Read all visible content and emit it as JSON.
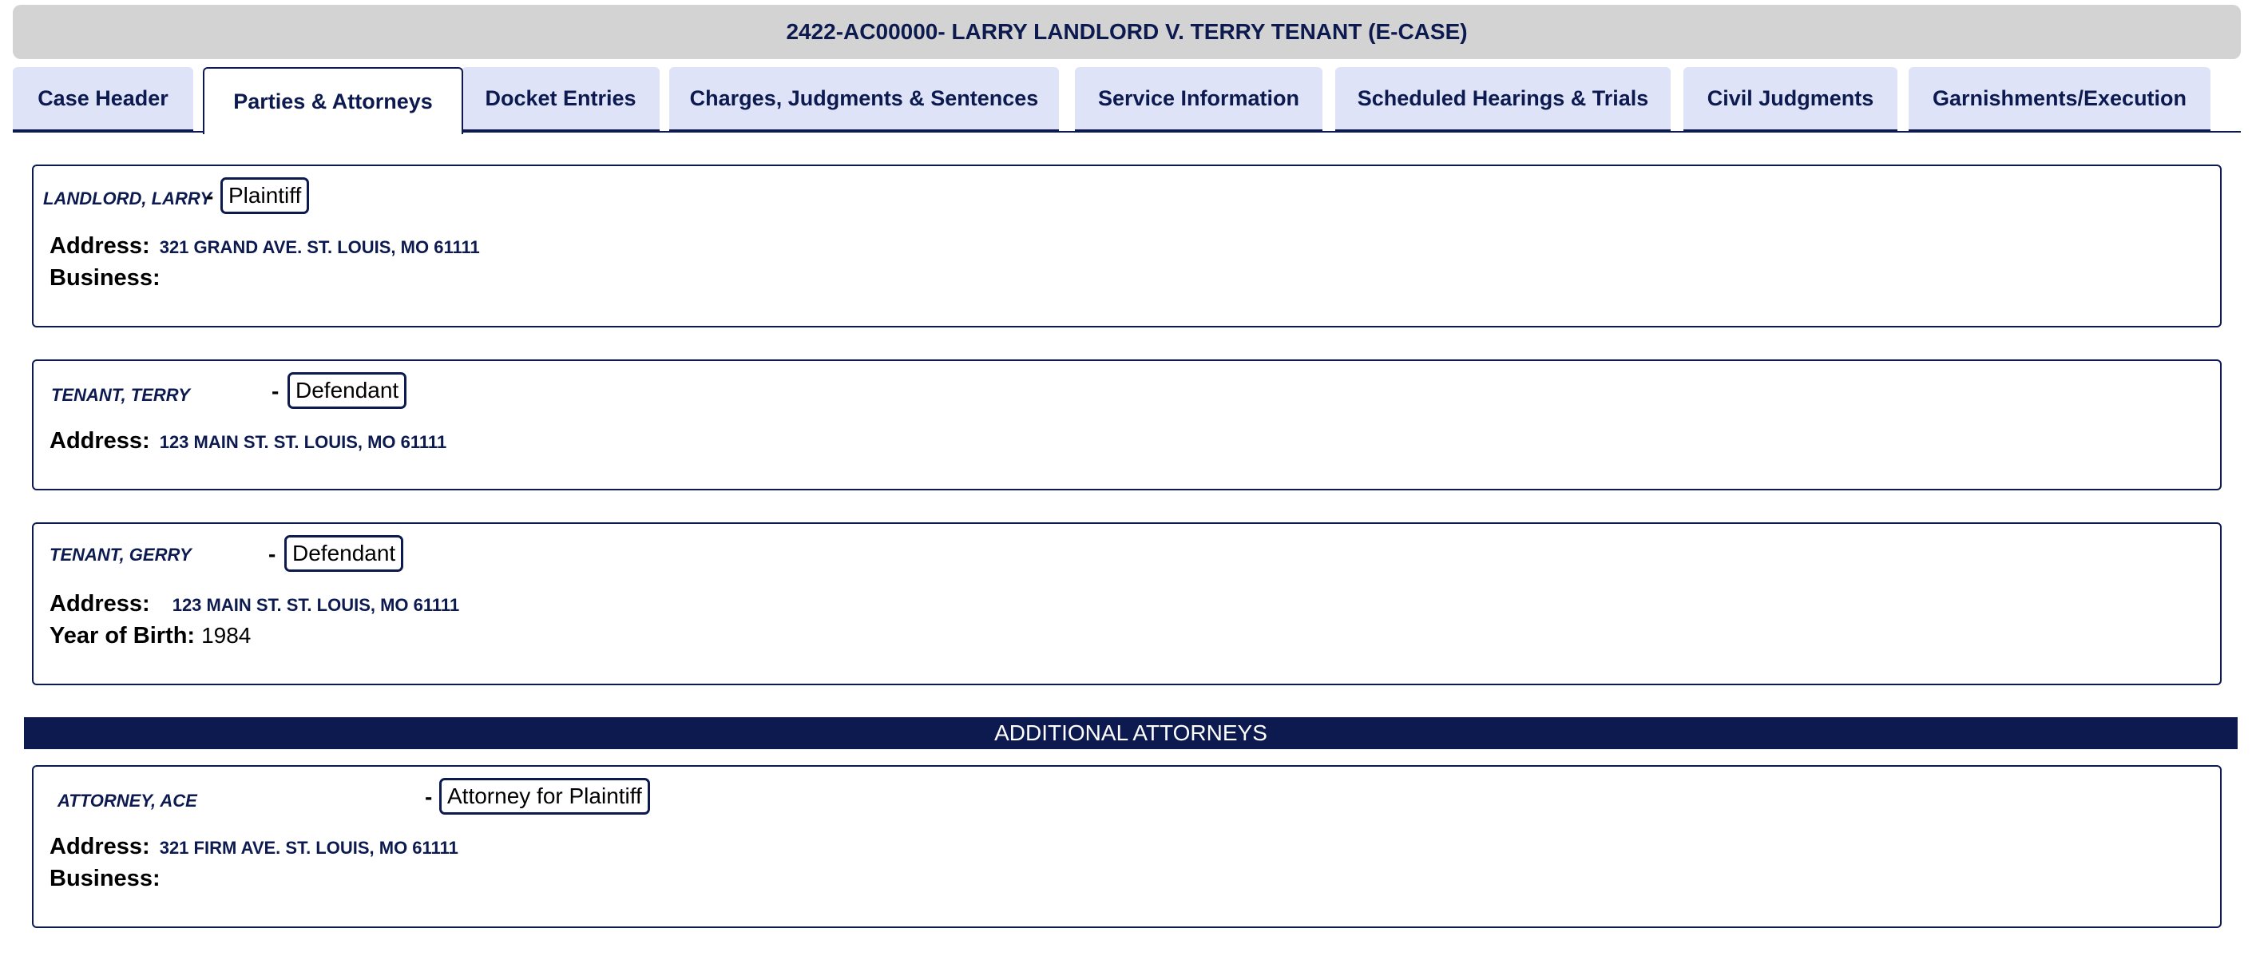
{
  "header": {
    "title": "2422-AC00000- LARRY LANDLORD V. TERRY TENANT (E-CASE)"
  },
  "tabs": [
    {
      "label": "Case Header"
    },
    {
      "label": "Parties & Attorneys",
      "active": true
    },
    {
      "label": "Docket Entries"
    },
    {
      "label": "Charges, Judgments & Sentences"
    },
    {
      "label": "Service Information"
    },
    {
      "label": "Scheduled Hearings & Trials"
    },
    {
      "label": "Civil Judgments"
    },
    {
      "label": "Garnishments/Execution"
    }
  ],
  "labels": {
    "address": "Address:",
    "business": "Business:",
    "year_of_birth": "Year of Birth:",
    "dash": "-"
  },
  "parties": [
    {
      "name": "LANDLORD, LARRY",
      "role": "Plaintiff",
      "address": "321 GRAND AVE. ST. LOUIS, MO 61111",
      "business": ""
    },
    {
      "name": "TENANT, TERRY",
      "role": "Defendant",
      "address": "123 MAIN ST. ST. LOUIS, MO 61111"
    },
    {
      "name": "TENANT, GERRY",
      "role": "Defendant",
      "address": "123 MAIN ST. ST. LOUIS, MO 61111",
      "year_of_birth": "1984"
    }
  ],
  "additional_attorneys": {
    "heading": "ADDITIONAL ATTORNEYS",
    "items": [
      {
        "name": "ATTORNEY, ACE",
        "role": "Attorney for Plaintiff",
        "address": "321 FIRM AVE. ST. LOUIS, MO 61111",
        "business": ""
      }
    ]
  },
  "colors": {
    "navy": "#0c1a4f",
    "tab_bg": "#dfe3f7",
    "title_bg": "#d3d3d3"
  }
}
